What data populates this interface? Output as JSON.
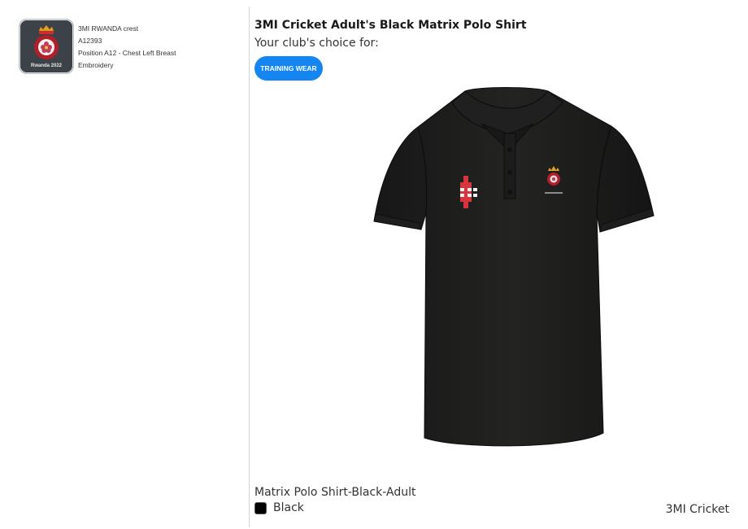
{
  "crest": {
    "caption": "Rwanda 2022",
    "name": "3MI RWANDA crest",
    "code": "A12393",
    "position": "Position A12 - Chest Left Breast",
    "method": "Embroidery"
  },
  "product": {
    "title": "3MI Cricket Adult's Black Matrix Polo Shirt",
    "choice_text": "Your club's choice for:",
    "tag": "TRAINING WEAR",
    "variant": "Matrix Polo Shirt-Black-Adult",
    "color_name": "Black",
    "color_hex": "#000000",
    "club": "3MI Cricket",
    "accent": "#1585f2"
  },
  "icons": {
    "crest_image": "crest-icon",
    "shirt_image": "polo-shirt-image",
    "swatch": "color-swatch"
  }
}
